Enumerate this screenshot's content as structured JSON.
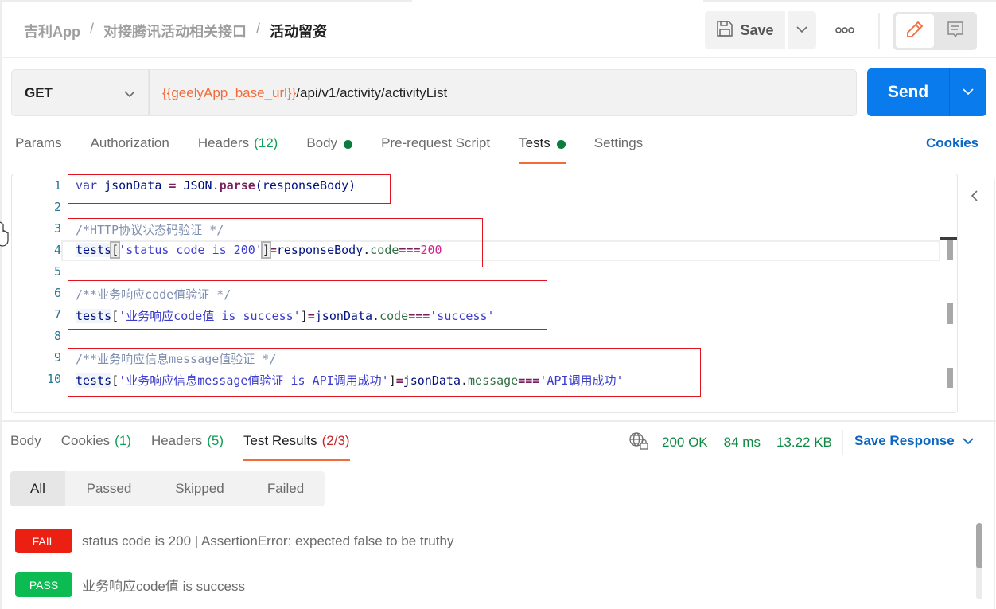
{
  "header": {
    "breadcrumb": [
      "吉利App",
      "对接腾讯活动相关接口",
      "活动留资"
    ],
    "breadcrumb_separator": "/",
    "save_label": "Save",
    "icons": {
      "save": "floppy-disk-icon",
      "save_caret": "chevron-down-icon",
      "more": "more-horizontal-icon",
      "edit_mode": "pencil-icon",
      "comments_mode": "comment-icon"
    }
  },
  "request": {
    "method": "GET",
    "url_variable": "{{geelyApp_base_url}}",
    "url_path": "/api/v1/activity/activityList",
    "send_label": "Send"
  },
  "request_tabs": [
    {
      "label": "Params",
      "count": null,
      "dot": false,
      "active": false
    },
    {
      "label": "Authorization",
      "count": null,
      "dot": false,
      "active": false
    },
    {
      "label": "Headers",
      "count": "(12)",
      "dot": false,
      "active": false
    },
    {
      "label": "Body",
      "count": null,
      "dot": true,
      "active": false
    },
    {
      "label": "Pre-request Script",
      "count": null,
      "dot": false,
      "active": false
    },
    {
      "label": "Tests",
      "count": null,
      "dot": true,
      "active": true
    },
    {
      "label": "Settings",
      "count": null,
      "dot": false,
      "active": false
    }
  ],
  "cookies_link": "Cookies",
  "editor": {
    "line_numbers": [
      "1",
      "2",
      "3",
      "4",
      "5",
      "6",
      "7",
      "8",
      "9",
      "10"
    ],
    "lines": {
      "l1": {
        "kw": "var",
        "var": "jsonData",
        "eq": "=",
        "obj": "JSON",
        "dot": ".",
        "fn": "parse",
        "args": "(responseBody)"
      },
      "l3": {
        "comment": "/*HTTP协议状态码验证 */"
      },
      "l4": {
        "tests": "tests",
        "lb": "[",
        "str": "'status code is 200'",
        "rb": "]",
        "eq": "=",
        "obj": "responseBody",
        "dot": ".",
        "prop": "code",
        "op": "===",
        "num": "200"
      },
      "l6": {
        "comment": "/**业务响应code值验证 */"
      },
      "l7": {
        "tests": "tests",
        "lb": "[",
        "str": "'业务响应code值 is success'",
        "rb": "]",
        "eq": "=",
        "obj": "jsonData",
        "dot": ".",
        "prop": "code",
        "op": "===",
        "str2": "'success'"
      },
      "l9": {
        "comment": "/**业务响应信息message值验证 */"
      },
      "l10": {
        "tests": "tests",
        "lb": "[",
        "str": "'业务响应信息message值验证 is API调用成功'",
        "rb": "]",
        "eq": "=",
        "obj": "jsonData",
        "dot": ".",
        "prop": "message",
        "op": "===",
        "str2": "'API调用成功'"
      }
    }
  },
  "response_tabs": [
    {
      "label": "Body",
      "count": null,
      "count_color": null,
      "active": false
    },
    {
      "label": "Cookies",
      "count": "(1)",
      "count_color": "green",
      "active": false
    },
    {
      "label": "Headers",
      "count": "(5)",
      "count_color": "green",
      "active": false
    },
    {
      "label": "Test Results",
      "count": "(2/3)",
      "count_color": "red",
      "active": true
    }
  ],
  "response_meta": {
    "status": "200 OK",
    "time": "84 ms",
    "size": "13.22 KB",
    "save_response_label": "Save Response",
    "network_icon": "globe-lock-icon"
  },
  "result_filters": [
    {
      "label": "All",
      "active": true
    },
    {
      "label": "Passed",
      "active": false
    },
    {
      "label": "Skipped",
      "active": false
    },
    {
      "label": "Failed",
      "active": false
    }
  ],
  "test_results": [
    {
      "status": "FAIL",
      "text": "status code is 200 | AssertionError: expected false to be truthy"
    },
    {
      "status": "PASS",
      "text": "业务响应code值 is success"
    }
  ],
  "colors": {
    "accent_orange": "#f26b3a",
    "send_blue": "#097bed",
    "link_blue": "#0b66c3",
    "success_green": "#0f8a45",
    "fail_red": "#eb2013",
    "pass_green": "#0cbb52",
    "annotation_red": "#e0141e"
  }
}
